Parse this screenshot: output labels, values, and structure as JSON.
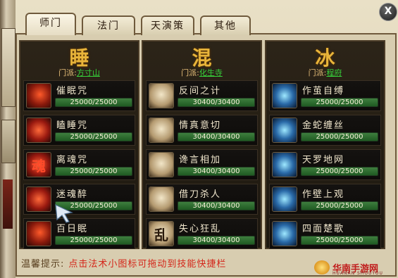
{
  "tabs": [
    {
      "label": "师门",
      "active": true
    },
    {
      "label": "法门",
      "active": false
    },
    {
      "label": "天演策",
      "active": false
    },
    {
      "label": "其他",
      "active": false
    }
  ],
  "close_label": "X",
  "sect_label": "门派:",
  "columns": [
    {
      "title": "睡",
      "sect": "方寸山",
      "skills": [
        {
          "name": "催眠咒",
          "value": "25000/25000",
          "fraction": 1.0,
          "icon": "fire-swirl-icon"
        },
        {
          "name": "瞌睡咒",
          "value": "25000/25000",
          "fraction": 1.0,
          "icon": "sleep-spell-icon"
        },
        {
          "name": "离魂咒",
          "value": "25000/25000",
          "fraction": 1.0,
          "icon": "soul-glyph-icon"
        },
        {
          "name": "迷魂醉",
          "value": "25000/25000",
          "fraction": 1.0,
          "icon": "spiral-icon"
        },
        {
          "name": "百日眠",
          "value": "25000/25000",
          "fraction": 1.0,
          "icon": "red-orb-icon"
        }
      ]
    },
    {
      "title": "混",
      "sect": "化生寺",
      "skills": [
        {
          "name": "反间之计",
          "value": "30400/30400",
          "fraction": 1.0,
          "icon": "mask-icon"
        },
        {
          "name": "情真意切",
          "value": "30400/30400",
          "fraction": 1.0,
          "icon": "embrace-icon"
        },
        {
          "name": "谗言相加",
          "value": "30400/30400",
          "fraction": 1.0,
          "icon": "whisper-icon"
        },
        {
          "name": "借刀杀人",
          "value": "30400/30400",
          "fraction": 1.0,
          "icon": "blade-icon"
        },
        {
          "name": "失心狂乱",
          "value": "30400/30400",
          "fraction": 1.0,
          "icon": "chaos-glyph-icon"
        }
      ]
    },
    {
      "title": "冰",
      "sect": "程府",
      "skills": [
        {
          "name": "作茧自缚",
          "value": "25000/25000",
          "fraction": 1.0,
          "icon": "cocoon-icon"
        },
        {
          "name": "金蛇缠丝",
          "value": "25000/25000",
          "fraction": 1.0,
          "icon": "serpent-icon"
        },
        {
          "name": "天罗地网",
          "value": "25000/25000",
          "fraction": 1.0,
          "icon": "net-icon"
        },
        {
          "name": "作壁上观",
          "value": "25000/25000",
          "fraction": 1.0,
          "icon": "wall-icon"
        },
        {
          "name": "四面楚歌",
          "value": "25000/25000",
          "fraction": 1.0,
          "icon": "siege-icon"
        }
      ]
    }
  ],
  "hint": {
    "label": "温馨提示:",
    "message": "点击法术小图标可拖动到技能快捷栏"
  },
  "watermark": {
    "text": "华南手游网",
    "sub": "HUANAN SHOUYOU"
  },
  "colors": {
    "title": "#e8b43a",
    "sect_value": "#37d23a",
    "bar_fill": "#3e7e3e",
    "hint": "#d4261a"
  }
}
